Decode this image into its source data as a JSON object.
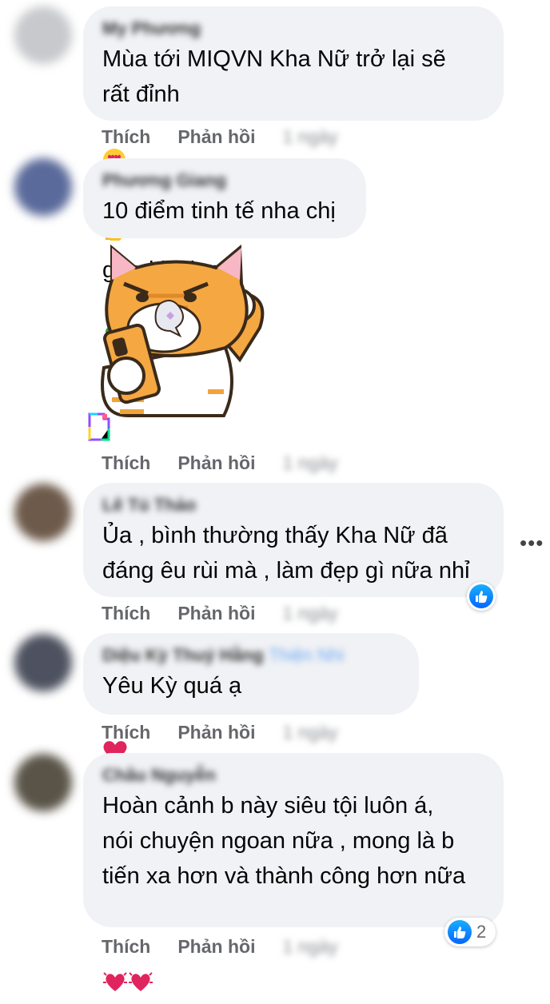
{
  "actions": {
    "like_label": "Thích",
    "reply_label": "Phản hồi"
  },
  "comments": [
    {
      "author": "My Phương",
      "text": "Mùa tới MIQVN Kha Nữ trở lại sẽ\nrất đỉnh",
      "text_after_emoji": "good luck e",
      "emojis": [
        "heart-eyes-emoji",
        "thumbs-up-emoji",
        "clover-emoji"
      ],
      "time": "1 ngày"
    },
    {
      "author": "Phương Giang",
      "text": "10 điểm tinh tế nha chị",
      "sticker": "orange-cat-sticker",
      "time": "1 ngày"
    },
    {
      "author": "Lê Tú Thảo",
      "text": "Ủa , bình thường thấy Kha Nữ đã\nđáng êu rùi mà , làm đẹp gì nữa nhỉ",
      "reaction": "like-icon",
      "time": "1 ngày"
    },
    {
      "author": "Diệu Kỳ Thuý Hằng",
      "tag": "Thiện Nhi",
      "text": "Yêu Kỳ quá ạ",
      "emojis": [
        "red-heart-emoji"
      ],
      "time": "1 ngày"
    },
    {
      "author": "Châu Nguyễn",
      "text": "Hoàn cảnh b này siêu tội luôn á,\nnói chuyện ngoan nữa , mong là b\ntiến xa hơn và thành công hơn nữa",
      "emojis": [
        "sparkling-heart-emoji",
        "sparkling-heart-emoji"
      ],
      "reaction": "like-icon",
      "reaction_count": "2",
      "time": "1 ngày"
    }
  ],
  "colors": {
    "bubble": "#f0f2f5",
    "action_text": "#65676b",
    "like_blue": "#0866ff",
    "heart_red": "#e0245e"
  }
}
